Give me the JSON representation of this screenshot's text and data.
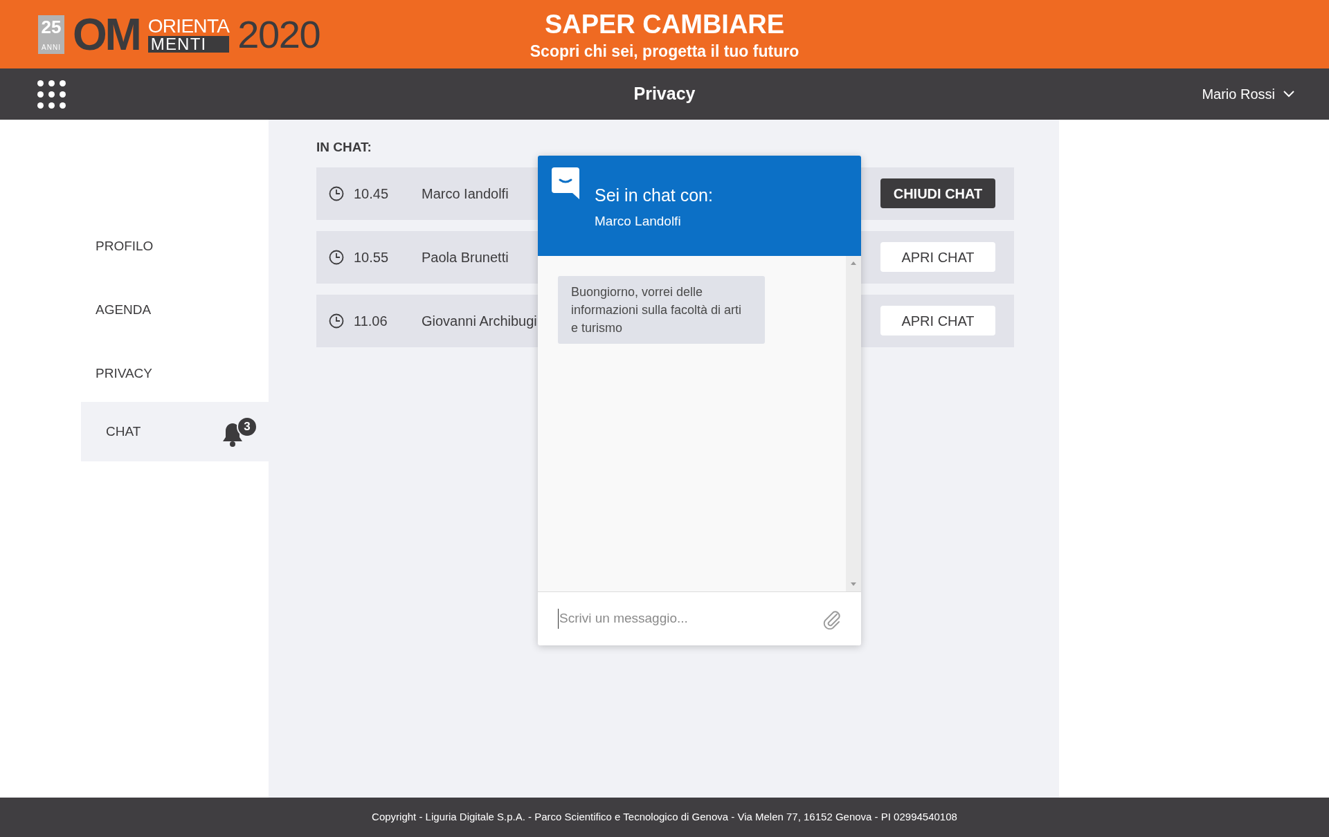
{
  "header": {
    "logo": {
      "badge_number": "25",
      "badge_text": "ANNI",
      "letters": "OM",
      "word_top": "ORIENTA",
      "word_bottom": "MENTI",
      "year": "2020"
    },
    "title": "SAPER CAMBIARE",
    "subtitle": "Scopri chi sei, progetta il tuo futuro"
  },
  "nav": {
    "title": "Privacy",
    "user": "Mario Rossi"
  },
  "sidebar": {
    "items": [
      {
        "label": "PROFILO",
        "selected": false
      },
      {
        "label": "AGENDA",
        "selected": false
      },
      {
        "label": "PRIVACY",
        "selected": false
      },
      {
        "label": "CHAT",
        "selected": true,
        "badge": "3"
      }
    ]
  },
  "in_chat": {
    "heading": "IN CHAT:",
    "rows": [
      {
        "time": "10.45",
        "name": "Marco Iandolfi",
        "open": true,
        "button": "CHIUDI CHAT"
      },
      {
        "time": "10.55",
        "name": "Paola Brunetti",
        "open": false,
        "button": "APRI CHAT"
      },
      {
        "time": "11.06",
        "name": "Giovanni Archibugi",
        "open": false,
        "button": "APRI CHAT"
      }
    ]
  },
  "chat_window": {
    "title": "Sei in chat con:",
    "contact": "Marco Landolfi",
    "messages": [
      "Buongiorno, vorrei delle informazioni sulla facoltà di arti e turismo"
    ],
    "input": {
      "placeholder": "Scrivi un messaggio..."
    }
  },
  "footer": "Copyright - Liguria Digitale S.p.A. - Parco Scientifico e Tecnologico di Genova - Via Melen 77, 16152 Genova - PI 02994540108"
}
